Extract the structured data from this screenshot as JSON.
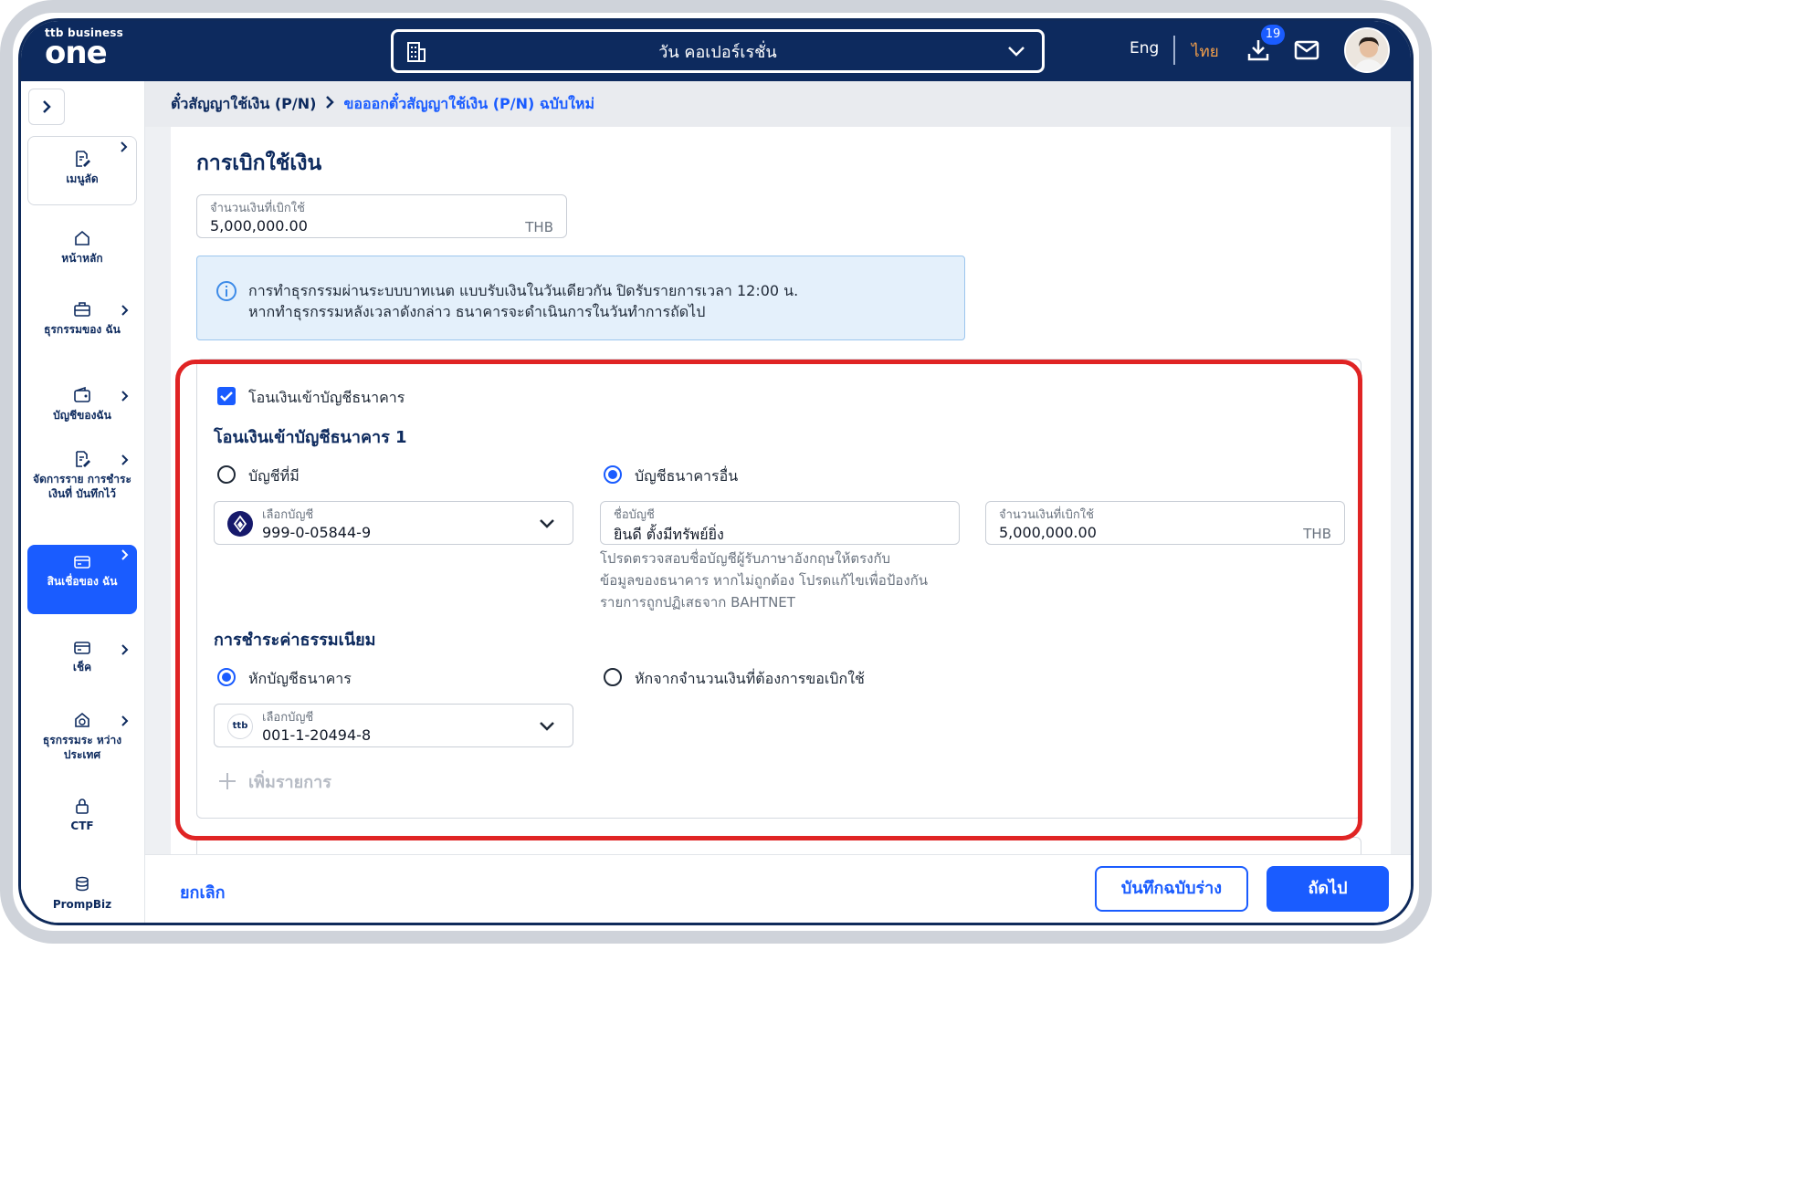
{
  "header": {
    "logo_small": "ttb business",
    "logo_big": "one",
    "company": "วัน คอเปอร์เรชั่น",
    "lang_en": "Eng",
    "lang_th": "ไทย",
    "download_badge": "19",
    "colors": {
      "header_bg": "#0d2a5e",
      "accent": "#1a5cff",
      "lang_active": "#f5a04a"
    }
  },
  "sidebar": {
    "items": [
      {
        "label": "เมนูลัด",
        "icon": "document-edit-icon"
      },
      {
        "label": "หน้าหลัก",
        "icon": "home-icon"
      },
      {
        "label": "ธุรกรรมของ ฉัน",
        "icon": "briefcase-icon"
      },
      {
        "label": "บัญชีของฉัน",
        "icon": "wallet-icon"
      },
      {
        "label": "จัดการราย การชำระเงินที่ บันทึกไว้",
        "icon": "document-edit-icon"
      },
      {
        "label": "สินเชื่อของ ฉัน",
        "icon": "card-icon"
      },
      {
        "label": "เช็ค",
        "icon": "cheque-icon"
      },
      {
        "label": "ธุรกรรมระ หว่างประเทศ",
        "icon": "global-house-icon"
      },
      {
        "label": "CTF",
        "icon": "lock-icon"
      },
      {
        "label": "PrompBiz",
        "icon": "coins-icon"
      }
    ]
  },
  "breadcrumb": {
    "item1": "ตั๋วสัญญาใช้เงิน (P/N)",
    "item2": "ขอออกตั๋วสัญญาใช้เงิน (P/N) ฉบับใหม่"
  },
  "main": {
    "title": "การเบิกใช้เงิน",
    "amount_field": {
      "label": "จำนวนเงินที่เบิกใช้",
      "value": "5,000,000.00",
      "unit": "THB"
    },
    "info": {
      "line1": "การทำธุรกรรมผ่านระบบบาทเนต แบบรับเงินในวันเดียวกัน ปิดรับรายการเวลา 12:00 น.",
      "line2": "หากทำธุรกรรมหลังเวลาดังกล่าว ธนาคารจะดำเนินการในวันทำการถัดไป"
    },
    "transfer": {
      "checkbox_label": "โอนเงินเข้าบัญชีธนาคาร",
      "section_title": "โอนเงินเข้าบัญชีธนาคาร 1",
      "radio_existing": "บัญชีที่มี",
      "radio_other": "บัญชีธนาคารอื่น",
      "select_account": {
        "label": "เลือกบัญชี",
        "value": "999-0-05844-9"
      },
      "account_name": {
        "label": "ชื่อบัญชี",
        "value": "ยินดี ตั้งมีทรัพย์ยิ่ง"
      },
      "amount": {
        "label": "จำนวนเงินที่เบิกใช้",
        "value": "5,000,000.00",
        "unit": "THB"
      },
      "hint_line1": "โปรดตรวจสอบชื่อบัญชีผู้รับภาษาอังกฤษให้ตรงกับ",
      "hint_line2": "ข้อมูลของธนาคาร หากไม่ถูกต้อง โปรดแก้ไขเพื่อป้องกัน",
      "hint_line3": "รายการถูกปฏิเสธจาก BAHTNET"
    },
    "fee": {
      "section_title": "การชำระค่าธรรมเนียม",
      "radio_deduct_account": "หักบัญชีธนาคาร",
      "radio_deduct_amount": "หักจากจำนวนเงินที่ต้องการขอเบิกใช้",
      "select_account": {
        "label": "เลือกบัญชี",
        "value": "001-1-20494-8",
        "bank_mark": "ttb"
      }
    },
    "add_item": "เพิ่มรายการ"
  },
  "footer": {
    "cancel": "ยกเลิก",
    "save_draft": "บันทึกฉบับร่าง",
    "next": "ถัดไป"
  }
}
